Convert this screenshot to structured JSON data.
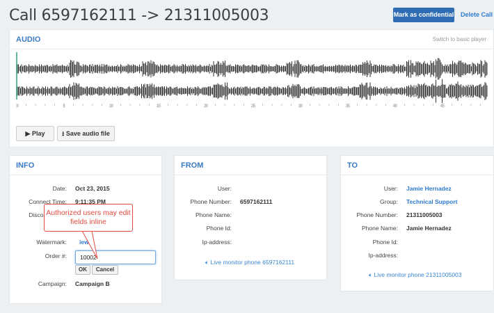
{
  "page": {
    "title": "Call 6597162111 -> 21311005003",
    "mark_confidential": "Mark as confidential",
    "delete_call": "Delete Call"
  },
  "audio": {
    "heading": "AUDIO",
    "switch_player": "Switch to basic player",
    "timeline_ticks": [
      "0",
      "5",
      "10",
      "15",
      "20",
      "25",
      "30",
      "35",
      "40",
      "45"
    ],
    "play_icon": "play-icon",
    "play_label": "Play",
    "save_icon": "download-icon",
    "save_label": "Save audio file",
    "waveform_color": "#333333",
    "cursor_color": "#2aa87e"
  },
  "info": {
    "heading": "INFO",
    "date_label": "Date:",
    "date_value": "Oct 23, 2015",
    "connect_label": "Connect Time:",
    "connect_value": "9:11:35 PM",
    "disconnect_label": "Disconn",
    "watermark_label": "Watermark:",
    "watermark_value": "iew",
    "order_label": "Order #:",
    "order_value": "10002",
    "ok_label": "OK",
    "cancel_label": "Cancel",
    "campaign_label": "Campaign:",
    "campaign_value": "Campaign B",
    "callout_text": "Authorized users may edit fields inline"
  },
  "from": {
    "heading": "FROM",
    "user_label": "User:",
    "phone_number_label": "Phone Number:",
    "phone_number_value": "6597162111",
    "phone_name_label": "Phone Name:",
    "phone_id_label": "Phone Id:",
    "ip_label": "Ip-address:",
    "monitor_icon": "speaker-icon",
    "monitor_label": "Live monitor phone 6597162111"
  },
  "to": {
    "heading": "TO",
    "user_label": "User:",
    "user_value": "Jamie Hernadez",
    "group_label": "Group:",
    "group_value": "Technical Support",
    "phone_number_label": "Phone Number:",
    "phone_number_value": "21311005003",
    "phone_name_label": "Phone Name:",
    "phone_name_value": "Jamie Hernadez",
    "phone_id_label": "Phone Id:",
    "ip_label": "Ip-address:",
    "monitor_icon": "speaker-icon",
    "monitor_label": "Live monitor phone 21311005003"
  },
  "colors": {
    "accent": "#2e6db4",
    "link": "#2e7bcf",
    "callout": "#e04a3f"
  }
}
